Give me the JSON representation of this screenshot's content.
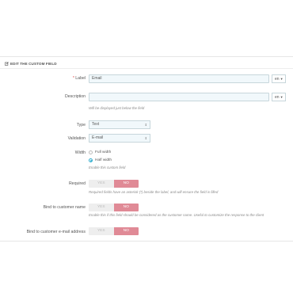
{
  "header": {
    "title": "EDIT THE CUSTOM FIELD",
    "icon": "pencil-square-icon"
  },
  "label_field": {
    "label": "Label",
    "required_mark": "*",
    "value": "Email",
    "lang": "en"
  },
  "description_field": {
    "label": "Description",
    "value": "",
    "lang": "en",
    "help": "Will be displayed just below the field"
  },
  "type_field": {
    "label": "Type",
    "value": "Text"
  },
  "validation_field": {
    "label": "Validation",
    "value": "E-mail"
  },
  "width_field": {
    "label": "Width",
    "options": [
      {
        "label": "Full width",
        "selected": false
      },
      {
        "label": "Half width",
        "selected": true
      }
    ],
    "help": "Enable this custom field"
  },
  "required_field": {
    "label": "Required",
    "yes": "YES",
    "no": "NO",
    "value": "NO",
    "help": "Required fields have an asterisk (*) beside the label, and will ensure the field is filled"
  },
  "bind_name_field": {
    "label": "Bind to customer name",
    "yes": "YES",
    "no": "NO",
    "value": "NO",
    "help": "Enable this if this field should be considered as the customer name. Useful to customize the response to the client"
  },
  "bind_email_field": {
    "label": "Bind to customer e-mail address",
    "yes": "YES",
    "no": "NO",
    "value": "NO"
  },
  "colors": {
    "accent": "#2eacce",
    "toggle_on": "#e08a96",
    "input_bg": "#f1f8fb"
  }
}
